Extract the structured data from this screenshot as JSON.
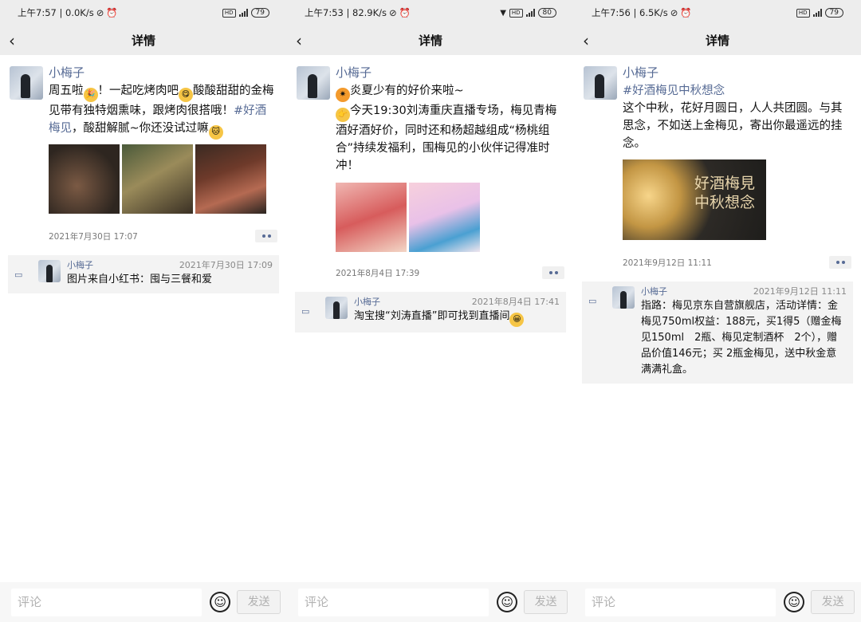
{
  "panels": [
    {
      "status": {
        "time": "上午7:57 | 0.0K/s",
        "signal": "4G",
        "battery": "79"
      },
      "nav": {
        "title": "详情"
      },
      "post": {
        "author": "小梅子",
        "text_a": "周五啦",
        "text_b": "！一起吃烤肉吧",
        "text_c": "酸酸甜甜的金梅见带有独特烟熏味，跟烤肉很搭哦！",
        "hashtag": "#好酒梅见",
        "text_d": "，酸甜解腻~你还没试过嘛",
        "time": "2021年7月30日 17:07"
      },
      "comment": {
        "author": "小梅子",
        "time": "2021年7月30日 17:09",
        "text": "图片来自小红书：囤与三餐和爱"
      },
      "bottom": {
        "placeholder": "评论",
        "send": "发送"
      }
    },
    {
      "status": {
        "time": "上午7:53 | 82.9K/s",
        "signal": "4G",
        "battery": "80"
      },
      "nav": {
        "title": "详情"
      },
      "post": {
        "author": "小梅子",
        "line1": "炎夏少有的好价来啦~",
        "line2": "今天19:30刘涛重庆直播专场，梅见青梅酒好酒好价，同时还和杨超越组成“杨桃组合”持续发福利，围梅见的小伙伴记得准时冲！",
        "time": "2021年8月4日 17:39"
      },
      "comment": {
        "author": "小梅子",
        "time": "2021年8月4日 17:41",
        "text": "淘宝搜“刘涛直播”即可找到直播间"
      },
      "bottom": {
        "placeholder": "评论",
        "send": "发送"
      }
    },
    {
      "status": {
        "time": "上午7:56 | 6.5K/s",
        "signal": "4G",
        "battery": "79"
      },
      "nav": {
        "title": "详情"
      },
      "post": {
        "author": "小梅子",
        "hashtag": "#好酒梅见中秋想念",
        "text": "这个中秋，花好月圆日，人人共团圆。与其思念，不如送上金梅见，寄出你最遥远的挂念。",
        "image_text": "好酒梅見\n中秋想念",
        "time": "2021年9月12日 11:11"
      },
      "comment": {
        "author": "小梅子",
        "time": "2021年9月12日 11:11",
        "text": "指路：梅见京东自营旗舰店，活动详情：金梅见750ml权益：188元，买1得5（赠金梅见150ml　2瓶、梅见定制酒杯　2个），赠品价值146元；买 2瓶金梅见，送中秋金意满满礼盒。"
      },
      "bottom": {
        "placeholder": "评论",
        "send": "发送"
      }
    }
  ],
  "icons": {
    "back": "back-arrow-icon",
    "comment": "comment-icon",
    "emoji": "emoji-icon",
    "more": "more-dots-icon"
  },
  "colors": {
    "link": "#576b95",
    "bar": "#ededed",
    "comment_bg": "#f3f3f3"
  }
}
